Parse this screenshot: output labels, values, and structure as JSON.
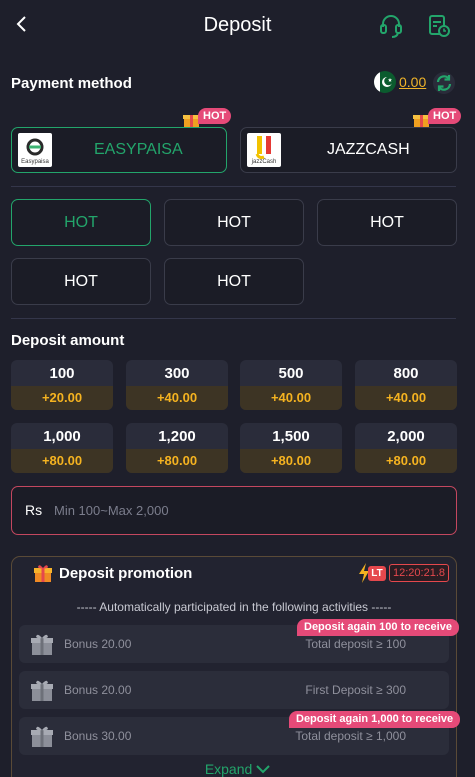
{
  "header": {
    "title": "Deposit",
    "back_icon": "back-arrow-icon",
    "support_icon": "headset-icon",
    "history_icon": "record-history-icon"
  },
  "payment": {
    "title": "Payment method",
    "balance": "0.00",
    "methods": [
      {
        "label": "EASYPAISA",
        "logo_text": "Easypaisa",
        "badge": "HOT",
        "active": true
      },
      {
        "label": "JAZZCASH",
        "logo_text": "jazzCash",
        "badge": "HOT",
        "active": false
      }
    ],
    "channels": [
      {
        "label": "HOT",
        "active": true
      },
      {
        "label": "HOT",
        "active": false
      },
      {
        "label": "HOT",
        "active": false
      },
      {
        "label": "HOT",
        "active": false
      },
      {
        "label": "HOT",
        "active": false
      }
    ]
  },
  "amount": {
    "title": "Deposit amount",
    "options": [
      {
        "value": "100",
        "bonus": "+20.00"
      },
      {
        "value": "300",
        "bonus": "+40.00"
      },
      {
        "value": "500",
        "bonus": "+40.00"
      },
      {
        "value": "800",
        "bonus": "+40.00"
      },
      {
        "value": "1,000",
        "bonus": "+80.00"
      },
      {
        "value": "1,200",
        "bonus": "+80.00"
      },
      {
        "value": "1,500",
        "bonus": "+80.00"
      },
      {
        "value": "2,000",
        "bonus": "+80.00"
      }
    ],
    "currency": "Rs",
    "placeholder": "Min 100~Max 2,000"
  },
  "promotion": {
    "title": "Deposit promotion",
    "lt_label": "LT",
    "timer": "12:20:21.8",
    "subtitle": "----- Automatically participated in the following activities -----",
    "activities": [
      {
        "bonus": "Bonus 20.00",
        "condition": "Total deposit ≥ 100",
        "tip": "Deposit again 100 to receive"
      },
      {
        "bonus": "Bonus 20.00",
        "condition": "First Deposit ≥ 300",
        "tip": ""
      },
      {
        "bonus": "Bonus 30.00",
        "condition": "Total deposit ≥ 1,000",
        "tip": "Deposit again 1,000 to receive"
      }
    ],
    "expand_label": "Expand"
  },
  "colors": {
    "accent": "#23a56b",
    "bonus": "#f5b320",
    "hot": "#e54a78",
    "bg": "#1e1f2b"
  }
}
